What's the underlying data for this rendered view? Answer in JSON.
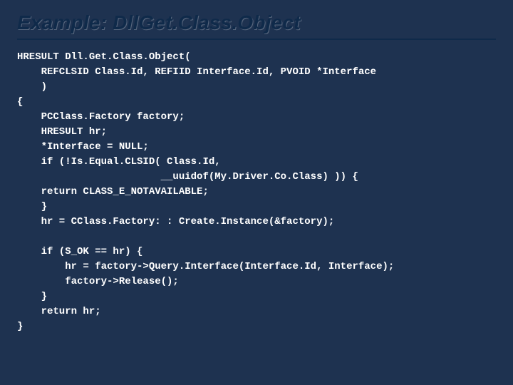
{
  "title": "Example: DllGet.Class.Object",
  "code": "HRESULT Dll.Get.Class.Object(\n    REFCLSID Class.Id, REFIID Interface.Id, PVOID *Interface\n    )\n{\n    PCClass.Factory factory;\n    HRESULT hr;\n    *Interface = NULL;\n    if (!Is.Equal.CLSID( Class.Id,\n                        __uuidof(My.Driver.Co.Class) )) {\n    return CLASS_E_NOTAVAILABLE;\n    }\n    hr = CClass.Factory: : Create.Instance(&factory);\n\n    if (S_OK == hr) {\n        hr = factory->Query.Interface(Interface.Id, Interface);\n        factory->Release();\n    }\n    return hr;\n}"
}
